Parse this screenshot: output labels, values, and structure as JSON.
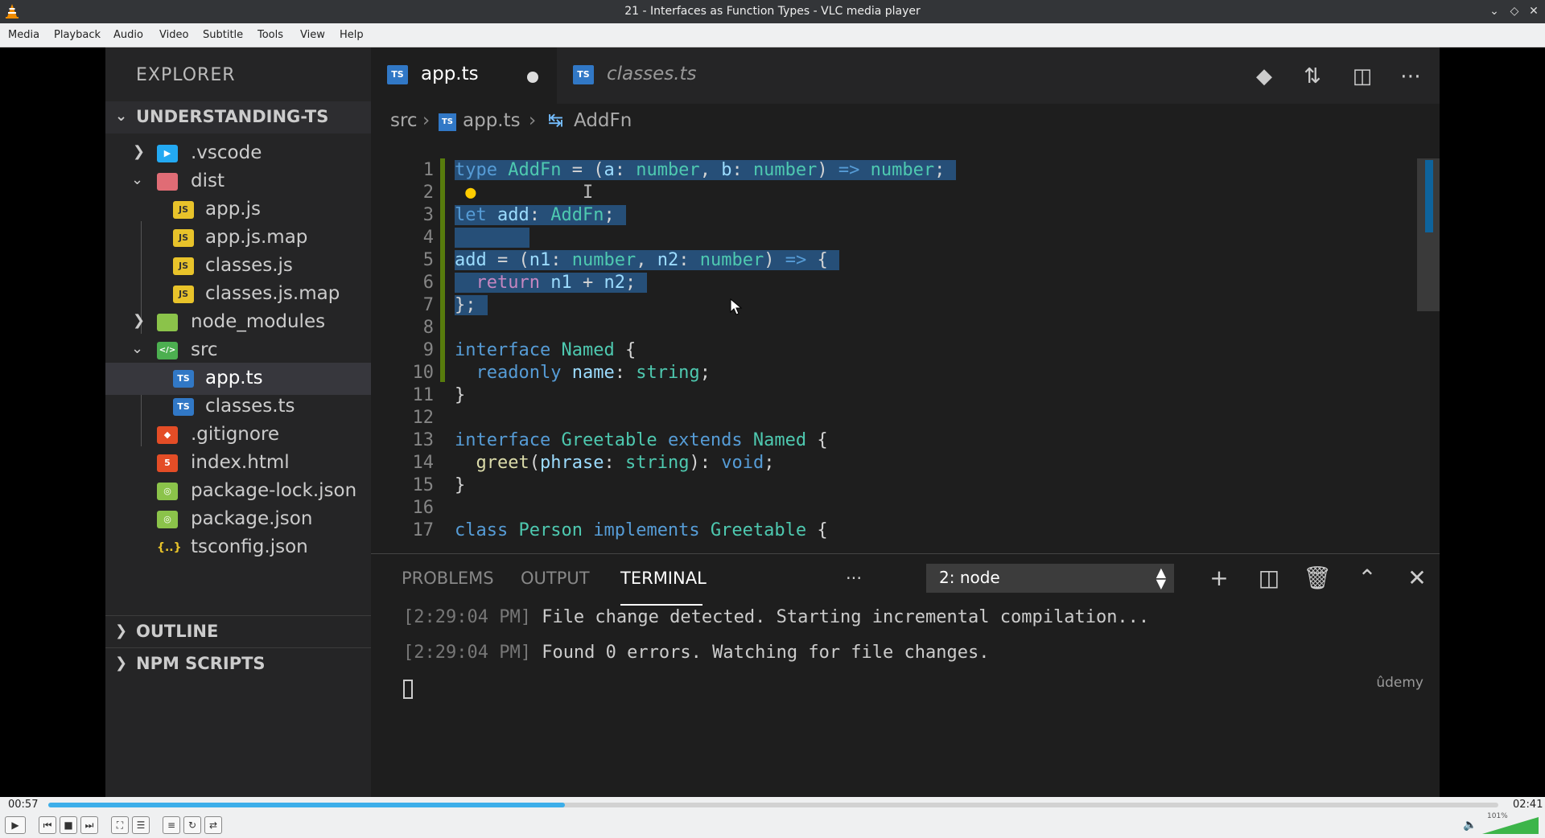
{
  "window": {
    "title": "21 - Interfaces as Function Types - VLC media player"
  },
  "menu": [
    "Media",
    "Playback",
    "Audio",
    "Video",
    "Subtitle",
    "Tools",
    "View",
    "Help"
  ],
  "sidebar": {
    "title": "EXPLORER",
    "project": "UNDERSTANDING-TS",
    "items": [
      {
        "name": ".vscode"
      },
      {
        "name": "dist"
      },
      {
        "name": "app.js"
      },
      {
        "name": "app.js.map"
      },
      {
        "name": "classes.js"
      },
      {
        "name": "classes.js.map"
      },
      {
        "name": "node_modules"
      },
      {
        "name": "src"
      },
      {
        "name": "app.ts"
      },
      {
        "name": "classes.ts"
      },
      {
        "name": ".gitignore"
      },
      {
        "name": "index.html"
      },
      {
        "name": "package-lock.json"
      },
      {
        "name": "package.json"
      },
      {
        "name": "tsconfig.json"
      }
    ],
    "outline": "OUTLINE",
    "npm_scripts": "NPM SCRIPTS"
  },
  "tabs": [
    {
      "label": "app.ts",
      "badge": "TS"
    },
    {
      "label": "classes.ts",
      "badge": "TS"
    }
  ],
  "breadcrumb": {
    "folder": "src",
    "file": "app.ts",
    "symbol": "AddFn"
  },
  "code": {
    "line_numbers": [
      "1",
      "2",
      "3",
      "4",
      "5",
      "6",
      "7",
      "8",
      "9",
      "10",
      "11",
      "12",
      "13",
      "14",
      "15",
      "16",
      "17"
    ]
  },
  "panel": {
    "tabs": [
      "PROBLEMS",
      "OUTPUT",
      "TERMINAL"
    ],
    "more": "···",
    "terminal_select": "2: node",
    "lines": [
      {
        "time": "[2:29:04 PM]",
        "text": " File change detected. Starting incremental compilation..."
      },
      {
        "time": "[2:29:04 PM]",
        "text": " Found 0 errors. Watching for file changes."
      }
    ],
    "watermark": "ûdemy"
  },
  "player": {
    "elapsed": "00:57",
    "total": "02:41",
    "progress": 0.356,
    "volume_label": "101%",
    "volume": 1.01
  },
  "colors": {
    "accent": "#3daee9",
    "selection": "#264f78",
    "ts_blue": "#3178c6"
  }
}
